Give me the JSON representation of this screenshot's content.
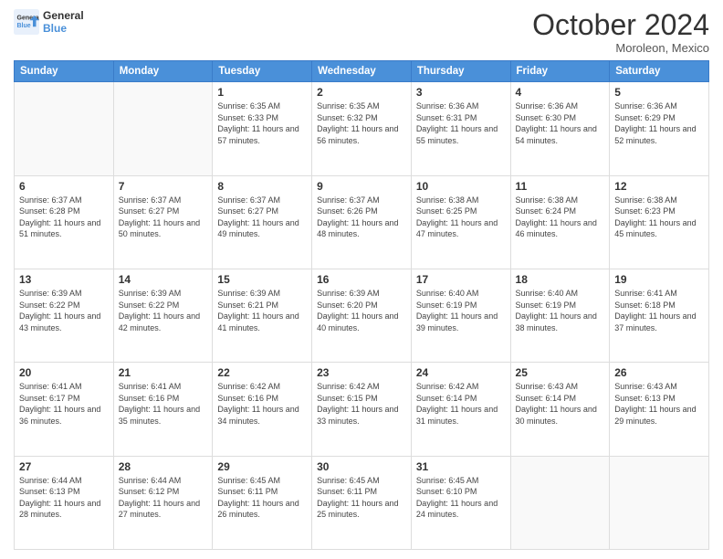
{
  "logo": {
    "line1": "General",
    "line2": "Blue"
  },
  "title": "October 2024",
  "location": "Moroleon, Mexico",
  "weekdays": [
    "Sunday",
    "Monday",
    "Tuesday",
    "Wednesday",
    "Thursday",
    "Friday",
    "Saturday"
  ],
  "weeks": [
    [
      {
        "day": "",
        "info": ""
      },
      {
        "day": "",
        "info": ""
      },
      {
        "day": "1",
        "info": "Sunrise: 6:35 AM\nSunset: 6:33 PM\nDaylight: 11 hours and 57 minutes."
      },
      {
        "day": "2",
        "info": "Sunrise: 6:35 AM\nSunset: 6:32 PM\nDaylight: 11 hours and 56 minutes."
      },
      {
        "day": "3",
        "info": "Sunrise: 6:36 AM\nSunset: 6:31 PM\nDaylight: 11 hours and 55 minutes."
      },
      {
        "day": "4",
        "info": "Sunrise: 6:36 AM\nSunset: 6:30 PM\nDaylight: 11 hours and 54 minutes."
      },
      {
        "day": "5",
        "info": "Sunrise: 6:36 AM\nSunset: 6:29 PM\nDaylight: 11 hours and 52 minutes."
      }
    ],
    [
      {
        "day": "6",
        "info": "Sunrise: 6:37 AM\nSunset: 6:28 PM\nDaylight: 11 hours and 51 minutes."
      },
      {
        "day": "7",
        "info": "Sunrise: 6:37 AM\nSunset: 6:27 PM\nDaylight: 11 hours and 50 minutes."
      },
      {
        "day": "8",
        "info": "Sunrise: 6:37 AM\nSunset: 6:27 PM\nDaylight: 11 hours and 49 minutes."
      },
      {
        "day": "9",
        "info": "Sunrise: 6:37 AM\nSunset: 6:26 PM\nDaylight: 11 hours and 48 minutes."
      },
      {
        "day": "10",
        "info": "Sunrise: 6:38 AM\nSunset: 6:25 PM\nDaylight: 11 hours and 47 minutes."
      },
      {
        "day": "11",
        "info": "Sunrise: 6:38 AM\nSunset: 6:24 PM\nDaylight: 11 hours and 46 minutes."
      },
      {
        "day": "12",
        "info": "Sunrise: 6:38 AM\nSunset: 6:23 PM\nDaylight: 11 hours and 45 minutes."
      }
    ],
    [
      {
        "day": "13",
        "info": "Sunrise: 6:39 AM\nSunset: 6:22 PM\nDaylight: 11 hours and 43 minutes."
      },
      {
        "day": "14",
        "info": "Sunrise: 6:39 AM\nSunset: 6:22 PM\nDaylight: 11 hours and 42 minutes."
      },
      {
        "day": "15",
        "info": "Sunrise: 6:39 AM\nSunset: 6:21 PM\nDaylight: 11 hours and 41 minutes."
      },
      {
        "day": "16",
        "info": "Sunrise: 6:39 AM\nSunset: 6:20 PM\nDaylight: 11 hours and 40 minutes."
      },
      {
        "day": "17",
        "info": "Sunrise: 6:40 AM\nSunset: 6:19 PM\nDaylight: 11 hours and 39 minutes."
      },
      {
        "day": "18",
        "info": "Sunrise: 6:40 AM\nSunset: 6:19 PM\nDaylight: 11 hours and 38 minutes."
      },
      {
        "day": "19",
        "info": "Sunrise: 6:41 AM\nSunset: 6:18 PM\nDaylight: 11 hours and 37 minutes."
      }
    ],
    [
      {
        "day": "20",
        "info": "Sunrise: 6:41 AM\nSunset: 6:17 PM\nDaylight: 11 hours and 36 minutes."
      },
      {
        "day": "21",
        "info": "Sunrise: 6:41 AM\nSunset: 6:16 PM\nDaylight: 11 hours and 35 minutes."
      },
      {
        "day": "22",
        "info": "Sunrise: 6:42 AM\nSunset: 6:16 PM\nDaylight: 11 hours and 34 minutes."
      },
      {
        "day": "23",
        "info": "Sunrise: 6:42 AM\nSunset: 6:15 PM\nDaylight: 11 hours and 33 minutes."
      },
      {
        "day": "24",
        "info": "Sunrise: 6:42 AM\nSunset: 6:14 PM\nDaylight: 11 hours and 31 minutes."
      },
      {
        "day": "25",
        "info": "Sunrise: 6:43 AM\nSunset: 6:14 PM\nDaylight: 11 hours and 30 minutes."
      },
      {
        "day": "26",
        "info": "Sunrise: 6:43 AM\nSunset: 6:13 PM\nDaylight: 11 hours and 29 minutes."
      }
    ],
    [
      {
        "day": "27",
        "info": "Sunrise: 6:44 AM\nSunset: 6:13 PM\nDaylight: 11 hours and 28 minutes."
      },
      {
        "day": "28",
        "info": "Sunrise: 6:44 AM\nSunset: 6:12 PM\nDaylight: 11 hours and 27 minutes."
      },
      {
        "day": "29",
        "info": "Sunrise: 6:45 AM\nSunset: 6:11 PM\nDaylight: 11 hours and 26 minutes."
      },
      {
        "day": "30",
        "info": "Sunrise: 6:45 AM\nSunset: 6:11 PM\nDaylight: 11 hours and 25 minutes."
      },
      {
        "day": "31",
        "info": "Sunrise: 6:45 AM\nSunset: 6:10 PM\nDaylight: 11 hours and 24 minutes."
      },
      {
        "day": "",
        "info": ""
      },
      {
        "day": "",
        "info": ""
      }
    ]
  ]
}
